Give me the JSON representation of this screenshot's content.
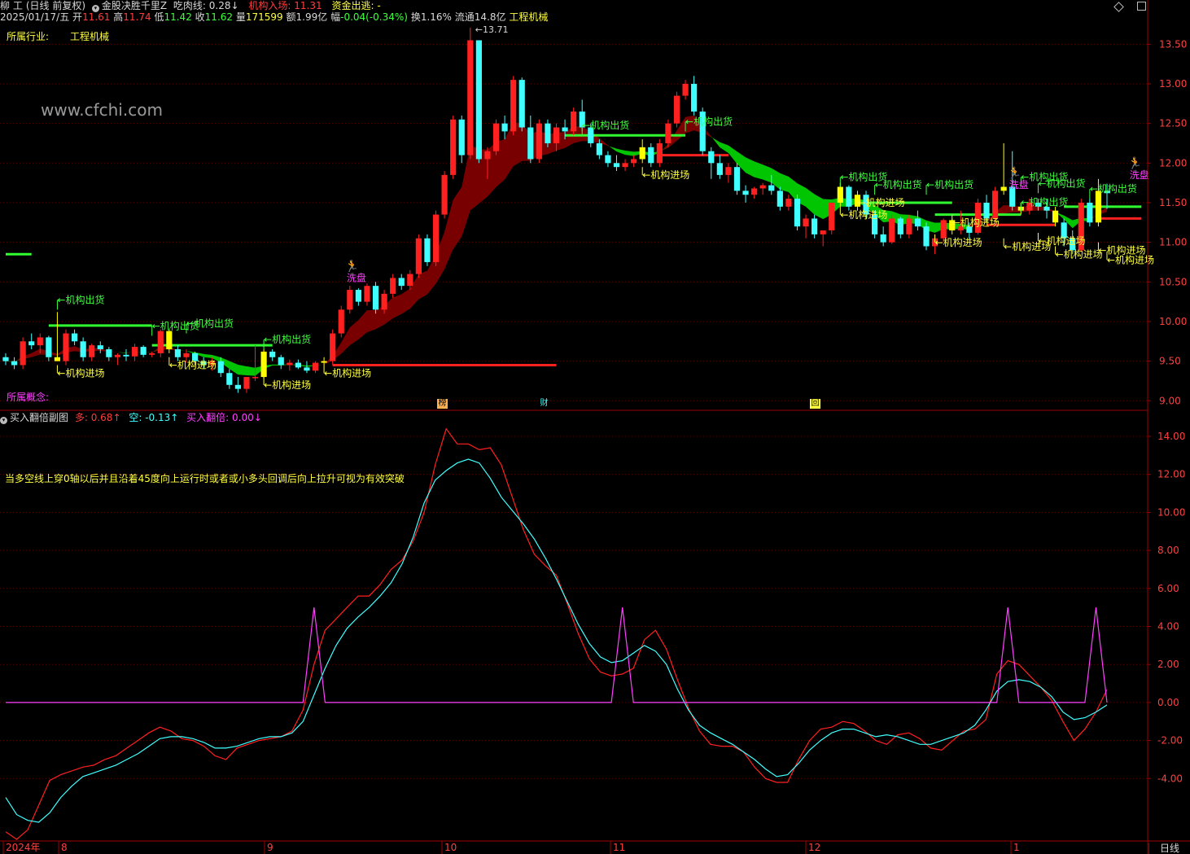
{
  "header": {
    "stock_name": "柳 工",
    "period": "(日线 前复权)",
    "indicator_name": "金股决胜千里Z",
    "indicator_fields": [
      {
        "label": "吃肉线:",
        "value": "0.28",
        "arrow": "↓",
        "color": "#d8d8d8"
      },
      {
        "label": "机构入场:",
        "value": "11.31",
        "arrow": "",
        "color": "#ff3c3c"
      },
      {
        "label": "资金出逃:",
        "value": "-",
        "arrow": "",
        "color": "#ffff40"
      }
    ]
  },
  "quote": {
    "date": "2025/01/17/五",
    "open_label": "开",
    "open": "11.61",
    "high_label": "高",
    "high": "11.74",
    "low_label": "低",
    "low": "11.42",
    "close_label": "收",
    "close": "11.62",
    "volume_label": "量",
    "volume": "171599",
    "amount_label": "额",
    "amount": "1.99亿",
    "change_label": "幅",
    "change": "-0.04(-0.34%)",
    "turnover_label": "换",
    "turnover": "1.16%",
    "float_label": "流通",
    "float": "14.8亿",
    "industry": "工程机械"
  },
  "main_panel": {
    "industry_label": "所属行业:",
    "industry_value": "工程机械",
    "concept_label": "所属概念:",
    "watermark": "www.cfchi.com",
    "high_marker": "13.71",
    "price_ticks": [
      "13.50",
      "13.00",
      "12.50",
      "12.00",
      "11.50",
      "11.00",
      "10.50",
      "10.00",
      "9.50",
      "9.00"
    ],
    "badges": [
      "榜",
      "财",
      "回"
    ],
    "colors": {
      "up": "#ff2020",
      "down": "#40ffff",
      "signal": "#ffff00",
      "band_down": "#00d000",
      "band_up": "#800000"
    }
  },
  "annotations": {
    "buy_label": "机构进场",
    "sell_label": "机构出货",
    "wash_label": "洗盘"
  },
  "sub_panel": {
    "title": "买入翻倍副图",
    "fields": [
      {
        "label": "多:",
        "value": "0.68",
        "arrow": "↑",
        "color": "#ff3c3c"
      },
      {
        "label": "空:",
        "value": "-0.13",
        "arrow": "↑",
        "color": "#40ffff"
      },
      {
        "label": "买入翻倍:",
        "value": "0.00",
        "arrow": "↓",
        "color": "#ff40ff"
      }
    ],
    "note": "当多空线上穿0轴以后并且沿着45度向上运行时或者或小多头回调后向上拉升可视为有效突破",
    "value_ticks": [
      "14.00",
      "12.00",
      "10.00",
      "8.00",
      "6.00",
      "4.00",
      "2.00",
      "0.00",
      "-2.00",
      "-4.00"
    ]
  },
  "time_axis": {
    "labels": [
      "2024年",
      "8",
      "9",
      "10",
      "11",
      "12",
      "1"
    ],
    "period_tab": "日线"
  },
  "chart_data": [
    {
      "type": "candlestick",
      "title": "",
      "ylim": [
        8.9,
        13.75
      ],
      "y_ticks": [
        13.5,
        13.0,
        12.5,
        12.0,
        11.5,
        11.0,
        10.5,
        10.0,
        9.5,
        9.0
      ],
      "grid": true,
      "ohlc": [
        [
          9.55,
          9.6,
          9.45,
          9.5
        ],
        [
          9.5,
          9.55,
          9.4,
          9.45
        ],
        [
          9.45,
          9.8,
          9.4,
          9.75
        ],
        [
          9.75,
          9.85,
          9.65,
          9.7
        ],
        [
          9.7,
          9.85,
          9.6,
          9.8
        ],
        [
          9.8,
          9.82,
          9.5,
          9.55
        ],
        [
          9.55,
          10.12,
          9.5,
          9.5
        ],
        [
          9.5,
          9.9,
          9.45,
          9.85
        ],
        [
          9.85,
          9.9,
          9.7,
          9.75
        ],
        [
          9.75,
          9.8,
          9.5,
          9.55
        ],
        [
          9.55,
          9.72,
          9.5,
          9.7
        ],
        [
          9.7,
          9.75,
          9.6,
          9.65
        ],
        [
          9.65,
          9.68,
          9.5,
          9.55
        ],
        [
          9.55,
          9.6,
          9.45,
          9.58
        ],
        [
          9.58,
          9.65,
          9.5,
          9.56
        ],
        [
          9.56,
          9.72,
          9.5,
          9.68
        ],
        [
          9.68,
          9.7,
          9.55,
          9.58
        ],
        [
          9.58,
          9.62,
          9.55,
          9.6
        ],
        [
          9.6,
          9.9,
          9.55,
          9.88
        ],
        [
          9.88,
          9.9,
          9.6,
          9.65
        ],
        [
          9.65,
          9.7,
          9.5,
          9.55
        ],
        [
          9.55,
          9.65,
          9.48,
          9.6
        ],
        [
          9.6,
          9.62,
          9.45,
          9.5
        ],
        [
          9.5,
          9.55,
          9.4,
          9.45
        ],
        [
          9.45,
          9.55,
          9.38,
          9.5
        ],
        [
          9.5,
          9.55,
          9.3,
          9.35
        ],
        [
          9.35,
          9.4,
          9.15,
          9.2
        ],
        [
          9.2,
          9.3,
          9.1,
          9.15
        ],
        [
          9.15,
          9.3,
          9.1,
          9.3
        ],
        [
          9.3,
          9.7,
          9.25,
          9.3
        ],
        [
          9.3,
          9.65,
          9.28,
          9.62
        ],
        [
          9.62,
          9.65,
          9.5,
          9.55
        ],
        [
          9.55,
          9.58,
          9.4,
          9.45
        ],
        [
          9.45,
          9.52,
          9.38,
          9.48
        ],
        [
          9.48,
          9.52,
          9.4,
          9.42
        ],
        [
          9.42,
          9.5,
          9.35,
          9.38
        ],
        [
          9.38,
          9.5,
          9.35,
          9.48
        ],
        [
          9.48,
          9.55,
          9.45,
          9.5
        ],
        [
          9.5,
          9.9,
          9.45,
          9.85
        ],
        [
          9.85,
          10.2,
          9.8,
          10.15
        ],
        [
          10.15,
          10.45,
          10.1,
          10.4
        ],
        [
          10.4,
          10.42,
          10.2,
          10.25
        ],
        [
          10.25,
          10.48,
          10.2,
          10.45
        ],
        [
          10.45,
          10.5,
          10.1,
          10.15
        ],
        [
          10.15,
          10.4,
          10.1,
          10.35
        ],
        [
          10.35,
          10.6,
          10.3,
          10.55
        ],
        [
          10.55,
          10.6,
          10.4,
          10.45
        ],
        [
          10.45,
          10.65,
          10.4,
          10.6
        ],
        [
          10.6,
          11.1,
          10.55,
          11.05
        ],
        [
          11.05,
          11.1,
          10.7,
          10.75
        ],
        [
          10.75,
          11.4,
          10.7,
          11.35
        ],
        [
          11.35,
          11.9,
          11.3,
          11.85
        ],
        [
          11.85,
          12.6,
          11.8,
          12.55
        ],
        [
          12.55,
          12.6,
          12.0,
          12.1
        ],
        [
          12.1,
          13.71,
          12.05,
          13.55
        ],
        [
          13.55,
          12.15,
          12.0,
          12.05
        ],
        [
          12.05,
          12.2,
          11.8,
          12.15
        ],
        [
          12.15,
          12.55,
          12.1,
          12.5
        ],
        [
          12.5,
          12.6,
          12.3,
          12.4
        ],
        [
          12.4,
          13.1,
          12.35,
          13.05
        ],
        [
          13.05,
          13.08,
          12.4,
          12.45
        ],
        [
          12.45,
          12.6,
          12.0,
          12.05
        ],
        [
          12.05,
          12.55,
          12.0,
          12.5
        ],
        [
          12.5,
          12.55,
          12.2,
          12.25
        ],
        [
          12.25,
          12.5,
          12.15,
          12.45
        ],
        [
          12.45,
          12.55,
          12.3,
          12.4
        ],
        [
          12.4,
          12.7,
          12.35,
          12.65
        ],
        [
          12.65,
          12.8,
          12.4,
          12.45
        ],
        [
          12.45,
          12.5,
          12.2,
          12.25
        ],
        [
          12.25,
          12.3,
          12.05,
          12.1
        ],
        [
          12.1,
          12.15,
          11.95,
          12.0
        ],
        [
          12.0,
          12.1,
          11.9,
          11.95
        ],
        [
          11.95,
          12.05,
          11.9,
          12.0
        ],
        [
          12.0,
          12.1,
          11.95,
          12.05
        ],
        [
          12.05,
          12.3,
          12.0,
          12.2
        ],
        [
          12.2,
          12.25,
          11.95,
          12.0
        ],
        [
          12.0,
          12.3,
          11.95,
          12.25
        ],
        [
          12.25,
          12.55,
          12.2,
          12.5
        ],
        [
          12.5,
          12.9,
          12.45,
          12.85
        ],
        [
          12.85,
          13.05,
          12.8,
          13.0
        ],
        [
          13.0,
          13.1,
          12.6,
          12.65
        ],
        [
          12.65,
          12.7,
          12.1,
          12.15
        ],
        [
          12.15,
          12.2,
          11.8,
          12.0
        ],
        [
          12.0,
          12.1,
          11.8,
          11.85
        ],
        [
          11.85,
          12.0,
          11.75,
          11.95
        ],
        [
          11.95,
          12.0,
          11.6,
          11.65
        ],
        [
          11.65,
          11.72,
          11.5,
          11.6
        ],
        [
          11.6,
          11.7,
          11.55,
          11.68
        ],
        [
          11.68,
          11.75,
          11.6,
          11.72
        ],
        [
          11.72,
          11.85,
          11.6,
          11.65
        ],
        [
          11.65,
          11.7,
          11.4,
          11.45
        ],
        [
          11.45,
          11.6,
          11.4,
          11.55
        ],
        [
          11.55,
          11.6,
          11.15,
          11.2
        ],
        [
          11.2,
          11.35,
          11.05,
          11.3
        ],
        [
          11.3,
          11.35,
          11.05,
          11.1
        ],
        [
          11.1,
          11.15,
          10.95,
          11.15
        ],
        [
          11.15,
          11.5,
          11.1,
          11.5
        ],
        [
          11.5,
          11.75,
          11.45,
          11.7
        ],
        [
          11.7,
          11.72,
          11.4,
          11.45
        ],
        [
          11.45,
          11.65,
          11.4,
          11.6
        ],
        [
          11.6,
          11.65,
          11.3,
          11.35
        ],
        [
          11.35,
          11.4,
          11.05,
          11.1
        ],
        [
          11.1,
          11.2,
          10.95,
          11.0
        ],
        [
          11.0,
          11.35,
          10.98,
          11.3
        ],
        [
          11.3,
          11.32,
          11.05,
          11.1
        ],
        [
          11.1,
          11.35,
          11.05,
          11.3
        ],
        [
          11.3,
          11.4,
          11.15,
          11.2
        ],
        [
          11.2,
          11.25,
          10.9,
          10.95
        ],
        [
          10.95,
          11.1,
          10.85,
          11.05
        ],
        [
          11.05,
          11.3,
          11.0,
          11.28
        ],
        [
          11.28,
          11.3,
          11.1,
          11.15
        ],
        [
          11.15,
          11.4,
          11.1,
          11.2
        ],
        [
          11.2,
          11.25,
          11.05,
          11.12
        ],
        [
          11.12,
          11.55,
          11.1,
          11.5
        ],
        [
          11.5,
          11.6,
          11.25,
          11.3
        ],
        [
          11.3,
          11.7,
          11.25,
          11.65
        ],
        [
          11.65,
          12.25,
          11.6,
          11.7
        ],
        [
          11.7,
          12.15,
          11.4,
          11.45
        ],
        [
          11.45,
          11.5,
          11.35,
          11.4
        ],
        [
          11.4,
          11.55,
          11.35,
          11.5
        ],
        [
          11.5,
          11.55,
          11.4,
          11.45
        ],
        [
          11.45,
          11.55,
          11.3,
          11.4
        ],
        [
          11.4,
          11.45,
          11.2,
          11.25
        ],
        [
          11.25,
          11.3,
          10.95,
          11.05
        ],
        [
          11.05,
          11.15,
          10.85,
          10.9
        ],
        [
          10.9,
          11.55,
          10.88,
          11.5
        ],
        [
          11.5,
          11.55,
          11.2,
          11.25
        ],
        [
          11.25,
          11.8,
          11.2,
          11.65
        ],
        [
          11.65,
          11.74,
          11.42,
          11.62
        ]
      ]
    },
    {
      "type": "line",
      "title": "",
      "ylim": [
        -7.2,
        14.6
      ],
      "y_ticks": [
        14,
        12,
        10,
        8,
        6,
        4,
        2,
        0,
        -2,
        -4
      ],
      "grid": true,
      "series": [
        {
          "name": "多",
          "color": "#ff2020",
          "values": [
            -6.8,
            -7.2,
            -6.7,
            -5.4,
            -4.1,
            -3.8,
            -3.6,
            -3.4,
            -3.3,
            -3.0,
            -2.8,
            -2.4,
            -2.0,
            -1.6,
            -1.3,
            -1.5,
            -1.9,
            -2.0,
            -2.3,
            -2.8,
            -3.0,
            -2.4,
            -2.2,
            -2.0,
            -1.9,
            -1.8,
            -1.5,
            -0.4,
            2.0,
            3.8,
            4.4,
            5.0,
            5.6,
            5.6,
            6.2,
            7.0,
            7.5,
            8.5,
            10.0,
            12.5,
            14.4,
            13.6,
            13.6,
            13.3,
            13.4,
            12.5,
            10.8,
            9.1,
            7.8,
            7.2,
            6.7,
            5.2,
            3.6,
            2.3,
            1.6,
            1.4,
            1.5,
            1.8,
            3.3,
            3.8,
            2.8,
            1.2,
            -0.3,
            -1.5,
            -2.2,
            -2.3,
            -2.3,
            -2.6,
            -3.4,
            -4.0,
            -4.2,
            -4.2,
            -3.0,
            -2.0,
            -1.4,
            -1.3,
            -1.0,
            -1.1,
            -1.5,
            -2.0,
            -2.2,
            -1.7,
            -1.6,
            -1.9,
            -2.4,
            -2.5,
            -2.0,
            -1.5,
            -1.4,
            -0.9,
            1.5,
            2.2,
            2.0,
            1.4,
            0.8,
            0.1,
            -1.0,
            -2.0,
            -1.4,
            -0.5,
            0.68
          ]
        },
        {
          "name": "空",
          "color": "#40ffff",
          "values": [
            -5.0,
            -5.9,
            -6.2,
            -6.3,
            -5.8,
            -5.0,
            -4.4,
            -3.9,
            -3.7,
            -3.5,
            -3.3,
            -3.0,
            -2.7,
            -2.3,
            -1.9,
            -1.8,
            -1.8,
            -1.9,
            -2.1,
            -2.4,
            -2.4,
            -2.3,
            -2.1,
            -1.9,
            -1.8,
            -1.8,
            -1.6,
            -1.0,
            0.4,
            1.8,
            3.0,
            3.9,
            4.5,
            5.0,
            5.6,
            6.3,
            7.3,
            8.7,
            10.5,
            11.7,
            12.2,
            12.6,
            12.8,
            12.6,
            11.8,
            10.8,
            10.1,
            9.4,
            8.6,
            7.6,
            6.5,
            5.3,
            4.1,
            3.1,
            2.4,
            2.1,
            2.2,
            2.6,
            3.0,
            2.7,
            2.0,
            0.7,
            -0.4,
            -1.2,
            -1.6,
            -1.9,
            -2.2,
            -2.6,
            -3.0,
            -3.5,
            -3.9,
            -3.8,
            -3.2,
            -2.5,
            -2.0,
            -1.6,
            -1.4,
            -1.4,
            -1.6,
            -1.8,
            -1.7,
            -1.8,
            -2.0,
            -2.2,
            -2.2,
            -2.0,
            -1.8,
            -1.6,
            -1.2,
            -0.4,
            0.6,
            1.1,
            1.2,
            1.1,
            0.8,
            0.3,
            -0.5,
            -0.9,
            -0.8,
            -0.5,
            -0.13
          ]
        },
        {
          "name": "买入翻倍",
          "color": "#ff40ff",
          "values": [
            0,
            0,
            0,
            0,
            0,
            0,
            0,
            0,
            0,
            0,
            0,
            0,
            0,
            0,
            0,
            0,
            0,
            0,
            0,
            0,
            0,
            0,
            0,
            0,
            0,
            0,
            0,
            0,
            5,
            0,
            0,
            0,
            0,
            0,
            0,
            0,
            0,
            0,
            0,
            0,
            0,
            0,
            0,
            0,
            0,
            0,
            0,
            0,
            0,
            0,
            0,
            0,
            0,
            0,
            0,
            0,
            5,
            0,
            0,
            0,
            0,
            0,
            0,
            0,
            0,
            0,
            0,
            0,
            0,
            0,
            0,
            0,
            0,
            0,
            0,
            0,
            0,
            0,
            0,
            0,
            0,
            0,
            0,
            0,
            0,
            0,
            0,
            0,
            0,
            0,
            0,
            5,
            0,
            0,
            0,
            0,
            0,
            0,
            0,
            5,
            0
          ]
        }
      ]
    }
  ]
}
